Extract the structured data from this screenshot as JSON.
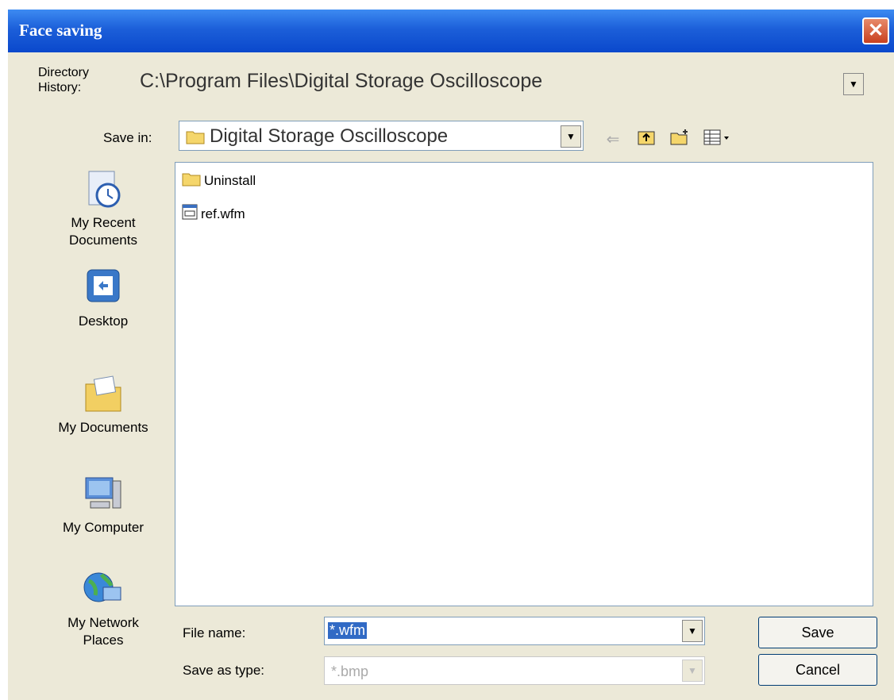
{
  "window": {
    "title": "Face saving"
  },
  "directory_history": {
    "label": "Directory History:",
    "value": "C:\\Program Files\\Digital Storage Oscilloscope"
  },
  "save_in": {
    "label": "Save in:",
    "value": "Digital Storage Oscilloscope"
  },
  "places": [
    {
      "label": "My Recent Documents",
      "icon": "recent-documents-icon"
    },
    {
      "label": "Desktop",
      "icon": "desktop-icon"
    },
    {
      "label": "My Documents",
      "icon": "my-documents-icon"
    },
    {
      "label": "My Computer",
      "icon": "my-computer-icon"
    },
    {
      "label": "My Network Places",
      "icon": "network-places-icon"
    }
  ],
  "files": [
    {
      "name": "Uninstall",
      "icon": "folder-icon"
    },
    {
      "name": "ref.wfm",
      "icon": "file-icon"
    }
  ],
  "file_name": {
    "label": "File name:",
    "value": "*.wfm"
  },
  "save_as_type": {
    "label": "Save as type:",
    "value": "*.bmp"
  },
  "buttons": {
    "save": "Save",
    "cancel": "Cancel"
  },
  "colors": {
    "titlebar": "#0a48cc",
    "dialog": "#ece9d8",
    "selection": "#316ac5"
  }
}
